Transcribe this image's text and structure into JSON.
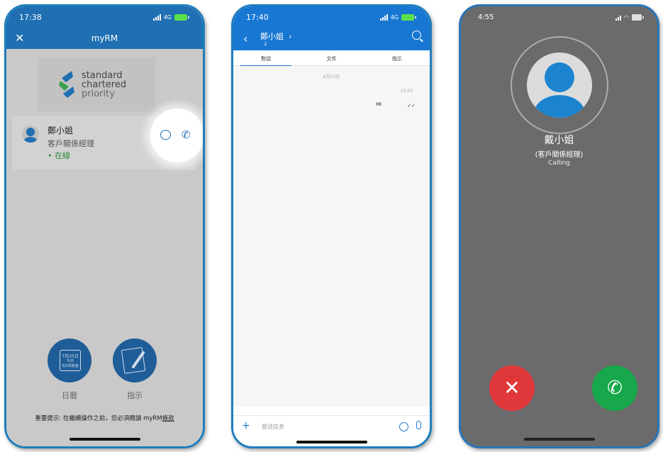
{
  "phone1": {
    "status_time": "17:38",
    "network": "4G",
    "title": "myRM",
    "brand": {
      "line1": "standard",
      "line2": "chartered",
      "line3": "priority"
    },
    "rm": {
      "name": "鄭小姐",
      "role": "客戶關係經理",
      "status": "• 在線"
    },
    "actions": {
      "calendar_label": "日曆",
      "instructions_label": "指示"
    },
    "calendar_icon_text": {
      "date": "7月25日",
      "today": "今日",
      "sub": "有3項會議"
    },
    "notice_prefix": "重要提示: 在繼續操作之前，您必須閱讀 myRM",
    "notice_link": "條款"
  },
  "phone2": {
    "status_time": "17:40",
    "network": "4G",
    "contact_name": "鄭小姐",
    "member_count": "2",
    "tabs": [
      "對話",
      "文件",
      "指示"
    ],
    "date_separator": "8月10日",
    "message_time": "15:59",
    "message_text": "HI",
    "input_placeholder": "發送信息"
  },
  "phone3": {
    "status_time": "4:55",
    "caller_name": "戴小姐",
    "caller_role": "(客戶關係經理)",
    "call_state": "Calling"
  },
  "colors": {
    "frame_blue": "#1f7dbd",
    "header_blue": "#1f6fb2",
    "chat_blue": "#1877d3",
    "decline_red": "#e0383a",
    "accept_green": "#16a84a"
  }
}
